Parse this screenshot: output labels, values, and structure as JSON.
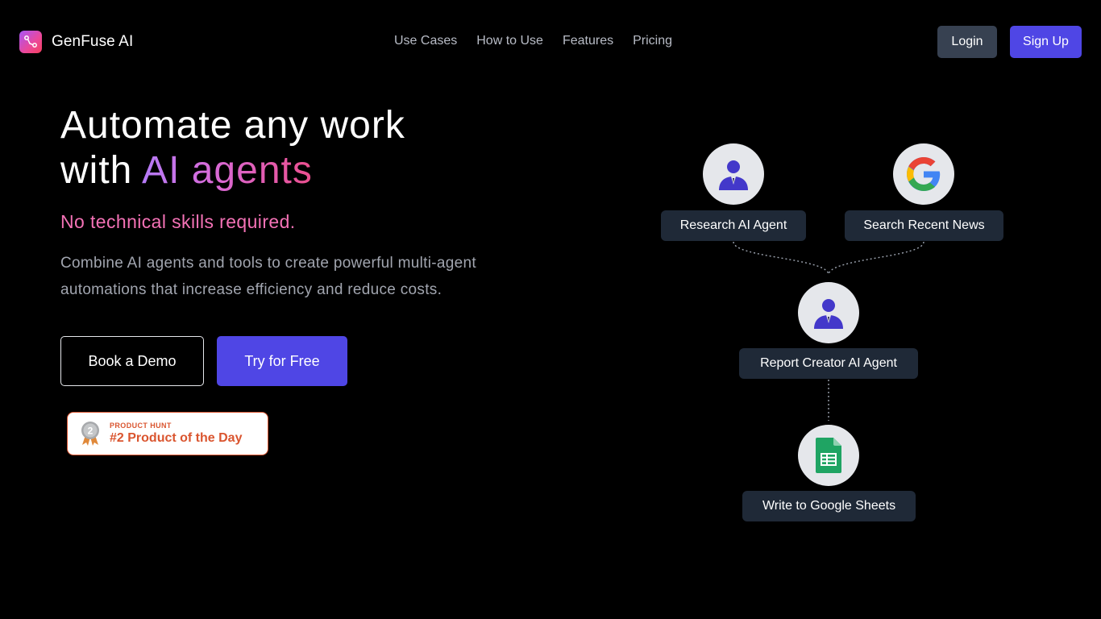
{
  "brand": {
    "name": "GenFuse AI",
    "logo_icon": "workflow-icon",
    "accent": "#4f46e5"
  },
  "nav": {
    "items": [
      "Use Cases",
      "How to Use",
      "Features",
      "Pricing"
    ]
  },
  "header": {
    "login_label": "Login",
    "signup_label": "Sign Up"
  },
  "hero": {
    "title_line1": "Automate any work",
    "title_line2_prefix": "with ",
    "title_line2_highlight": "AI agents",
    "subtitle": "No technical skills required.",
    "description": "Combine AI agents and tools to create powerful multi-agent automations that increase efficiency and reduce costs.",
    "demo_label": "Book a Demo",
    "try_label": "Try for Free"
  },
  "product_hunt": {
    "small_label": "PRODUCT HUNT",
    "big_label": "#2 Product of the Day",
    "medal_number": "2",
    "color": "#da552f"
  },
  "flow": {
    "nodes": [
      {
        "label": "Research AI Agent",
        "icon": "agent-icon"
      },
      {
        "label": "Search Recent News",
        "icon": "google-icon"
      },
      {
        "label": "Report Creator AI Agent",
        "icon": "agent-icon"
      },
      {
        "label": "Write to Google Sheets",
        "icon": "google-sheets-icon"
      }
    ]
  }
}
